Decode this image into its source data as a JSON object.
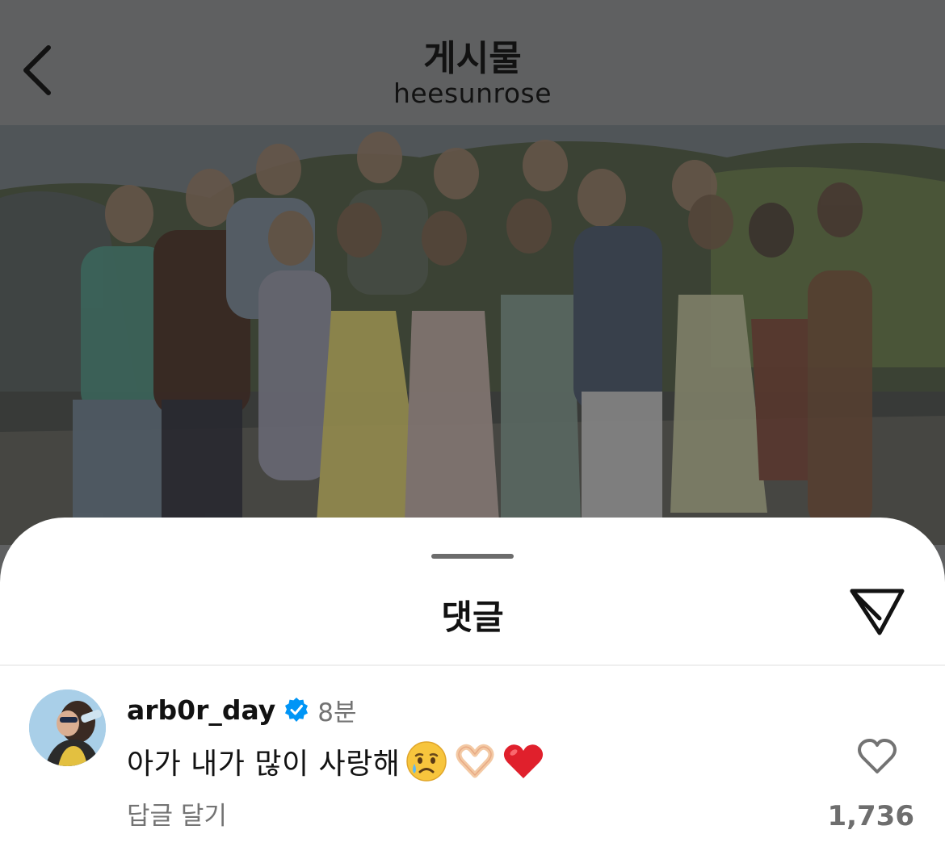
{
  "header": {
    "title": "게시물",
    "subtitle": "heesunrose",
    "back_icon": "chevron-left-icon"
  },
  "post": {
    "image_icon": "group-photo"
  },
  "comments_sheet": {
    "title": "댓글",
    "share_icon": "send-icon"
  },
  "comment": {
    "username": "arb0r_day",
    "verified_icon": "verified-badge-icon",
    "time": "8분",
    "text": "아가 내가 많이 사랑해",
    "emojis": [
      "crying-face-icon",
      "heart-hands-icon",
      "red-heart-icon"
    ],
    "reply_label": "답글 달기",
    "like_icon": "heart-outline-icon",
    "like_count": "1,736"
  },
  "colors": {
    "dim_overlay": "#5f6061",
    "text_primary": "#121212",
    "text_secondary": "#737373",
    "verified_blue": "#0095f6",
    "heart_red": "#e0202c"
  }
}
